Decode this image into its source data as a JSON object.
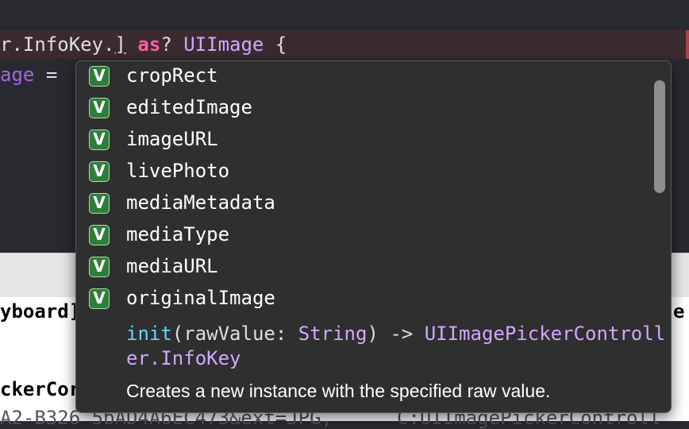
{
  "editor": {
    "line1": {
      "prefix": "r.InfoKey.",
      "bracket": "]",
      "kw": "as",
      "q": "?",
      "type": "UIImage",
      "brace": "{"
    },
    "line2": {
      "prop": "age",
      "eq": "="
    }
  },
  "debug": {
    "line1": "yboard]",
    "line1_right": "e",
    "line2": "ckerCor",
    "line3": "A2-B326 5bAD4A6EC473&ext=JPG,",
    "line3_right": "C:UIImagePickerControll"
  },
  "completion": {
    "items": [
      {
        "badge": "V",
        "label": "cropRect"
      },
      {
        "badge": "V",
        "label": "editedImage"
      },
      {
        "badge": "V",
        "label": "imageURL"
      },
      {
        "badge": "V",
        "label": "livePhoto"
      },
      {
        "badge": "V",
        "label": "mediaMetadata"
      },
      {
        "badge": "V",
        "label": "mediaType"
      },
      {
        "badge": "V",
        "label": "mediaURL"
      },
      {
        "badge": "V",
        "label": "originalImage"
      }
    ],
    "signature": {
      "init": "init",
      "open": "(",
      "param": "rawValue",
      "colon": ": ",
      "param_type": "String",
      "close": ")",
      "arrow": " -> ",
      "return_type": "UIImagePickerController.InfoKey"
    },
    "description": "Creates a new instance with the specified raw value."
  },
  "colors": {
    "editor_bg": "#292a30",
    "keyword": "#fc5fa3",
    "type": "#d0a8ff",
    "badge_green": "#2f7d3a",
    "popup_bg": "#2f2f2f"
  }
}
